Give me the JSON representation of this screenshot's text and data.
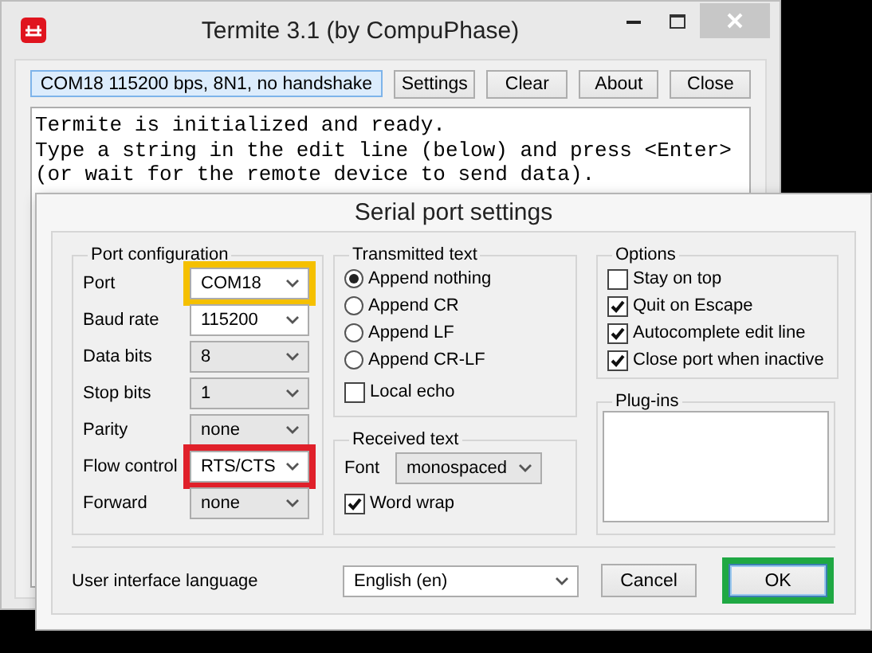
{
  "window": {
    "title": "Termite 3.1 (by CompuPhase)"
  },
  "toolbar": {
    "status": "COM18 115200 bps, 8N1, no handshake",
    "buttons": [
      "Settings",
      "Clear",
      "About",
      "Close"
    ]
  },
  "terminal": {
    "lines": [
      "Termite is initialized and ready.",
      "Type a string in the edit line (below) and press <Enter>",
      "(or wait for the remote device to send data)."
    ]
  },
  "dialog": {
    "title": "Serial port settings",
    "port_configuration": {
      "title": "Port configuration",
      "fields": [
        {
          "label": "Port",
          "value": "COM18",
          "color": "#f5c000"
        },
        {
          "label": "Baud rate",
          "value": "115200"
        },
        {
          "label": "Data bits",
          "value": "8"
        },
        {
          "label": "Stop bits",
          "value": "1"
        },
        {
          "label": "Parity",
          "value": "none"
        },
        {
          "label": "Flow control",
          "value": "RTS/CTS",
          "color": "#e0202a"
        },
        {
          "label": "Forward",
          "value": "none"
        }
      ]
    },
    "transmitted_text": {
      "title": "Transmitted text",
      "options": [
        {
          "label": "Append nothing",
          "selected": true
        },
        {
          "label": "Append CR",
          "selected": false
        },
        {
          "label": "Append LF",
          "selected": false
        },
        {
          "label": "Append CR-LF",
          "selected": false
        }
      ],
      "local_echo": {
        "label": "Local echo",
        "checked": false
      }
    },
    "received_text": {
      "title": "Received text",
      "font_label": "Font",
      "font_value": "monospaced",
      "word_wrap": {
        "label": "Word wrap",
        "checked": true
      }
    },
    "options": {
      "title": "Options",
      "items": [
        {
          "label": "Stay on top",
          "checked": false
        },
        {
          "label": "Quit on Escape",
          "checked": true
        },
        {
          "label": "Autocomplete edit line",
          "checked": true
        },
        {
          "label": "Close port when inactive",
          "checked": true
        }
      ]
    },
    "plugins": {
      "title": "Plug-ins"
    },
    "language": {
      "label": "User interface language",
      "value": "English (en)"
    },
    "buttons": [
      {
        "label": "Cancel",
        "default": false
      },
      {
        "label": "OK",
        "default": true,
        "color": "#1fa843"
      }
    ]
  }
}
